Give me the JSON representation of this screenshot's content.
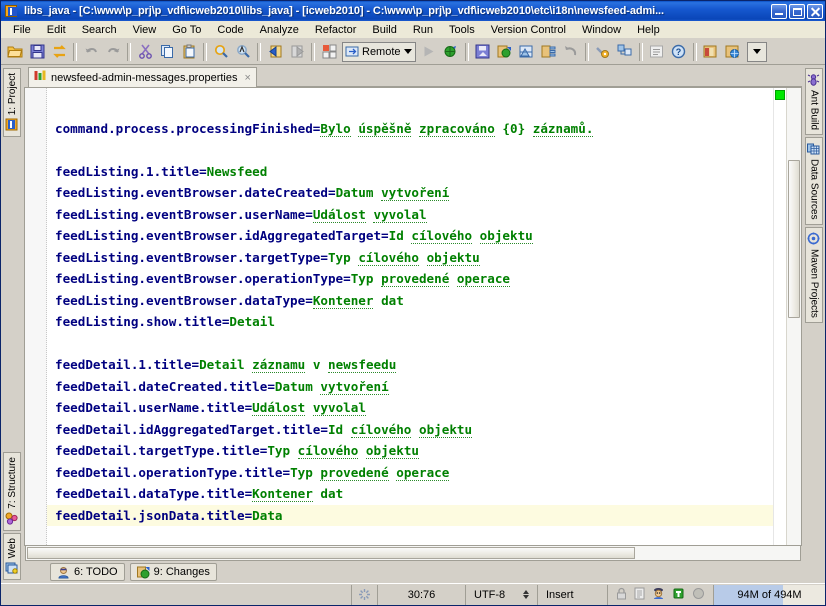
{
  "window": {
    "title": "libs_java - [C:\\www\\p_prj\\p_vdf\\icweb2010\\libs_java] - [icweb2010] - C:\\www\\p_prj\\p_vdf\\icweb2010\\etc\\i18n\\newsfeed-admi...",
    "minimize_label": "Minimize",
    "maximize_label": "Maximize",
    "close_label": "Close"
  },
  "menubar": {
    "items": [
      {
        "label": "File"
      },
      {
        "label": "Edit"
      },
      {
        "label": "Search"
      },
      {
        "label": "View"
      },
      {
        "label": "Go To"
      },
      {
        "label": "Code"
      },
      {
        "label": "Analyze"
      },
      {
        "label": "Refactor"
      },
      {
        "label": "Build"
      },
      {
        "label": "Run"
      },
      {
        "label": "Tools"
      },
      {
        "label": "Version Control"
      },
      {
        "label": "Window"
      },
      {
        "label": "Help"
      }
    ]
  },
  "toolbar": {
    "buttons": [
      {
        "name": "open-folder-icon",
        "title": "Open"
      },
      {
        "name": "save-all-icon",
        "title": "Save All"
      },
      {
        "name": "synchronize-icon",
        "title": "Synchronize"
      },
      {
        "name": "undo-icon",
        "title": "Undo"
      },
      {
        "name": "redo-icon",
        "title": "Redo"
      },
      {
        "name": "cut-icon",
        "title": "Cut"
      },
      {
        "name": "copy-icon",
        "title": "Copy"
      },
      {
        "name": "paste-icon",
        "title": "Paste"
      },
      {
        "name": "find-icon",
        "title": "Find"
      },
      {
        "name": "replace-icon",
        "title": "Replace"
      },
      {
        "name": "back-icon",
        "title": "Back"
      },
      {
        "name": "forward-icon",
        "title": "Forward"
      },
      {
        "name": "toggle-bookmark-icon",
        "title": "Toggle Bookmark"
      }
    ],
    "run_config": {
      "label": "Remote"
    },
    "buttons2": [
      {
        "name": "run-icon",
        "title": "Run"
      },
      {
        "name": "debug-icon",
        "title": "Debug"
      },
      {
        "name": "update-project-icon",
        "title": "Update Project"
      },
      {
        "name": "commit-icon",
        "title": "Commit Changes"
      },
      {
        "name": "compare-icon",
        "title": "Compare with the Same Repository Version"
      },
      {
        "name": "show-history-icon",
        "title": "Show History"
      },
      {
        "name": "rollback-icon",
        "title": "Rollback"
      },
      {
        "name": "settings-icon",
        "title": "Settings"
      },
      {
        "name": "project-structure-icon",
        "title": "Project Structure"
      },
      {
        "name": "context-help-icon",
        "title": "Context Help"
      },
      {
        "name": "help-icon",
        "title": "Help Topics"
      },
      {
        "name": "database-icon",
        "title": "Database"
      },
      {
        "name": "web-icon",
        "title": "Web"
      }
    ],
    "overflow_label": "More"
  },
  "left_strip": {
    "top_tabs": [
      {
        "label": "1: Project",
        "icon": "project-icon"
      }
    ],
    "bottom_tabs": [
      {
        "label": "7: Structure",
        "icon": "structure-icon"
      },
      {
        "label": "Web",
        "icon": "web-icon"
      }
    ]
  },
  "right_strip": {
    "tabs": [
      {
        "label": "Ant Build",
        "icon": "ant-icon"
      },
      {
        "label": "Data Sources",
        "icon": "database-icon"
      },
      {
        "label": "Maven Projects",
        "icon": "maven-icon"
      }
    ]
  },
  "editor": {
    "tab": {
      "filename": "newsfeed-admin-messages.properties",
      "icon": "properties-file-icon",
      "close_label": "×"
    },
    "inspection_status": "ok",
    "lines": [
      {
        "key": "",
        "value": "",
        "blank": true
      },
      {
        "key": "command.process.processingFinished",
        "value": "Bylo úspěšně zpracováno {0} záznamů.",
        "spell": "Bylo úspěšně zpracováno záznamů"
      },
      {
        "key": "",
        "value": "",
        "blank": true
      },
      {
        "key": "feedListing.1.title",
        "value": "Newsfeed"
      },
      {
        "key": "feedListing.eventBrowser.dateCreated",
        "value": "Datum vytvoření",
        "spell": "vytvoření"
      },
      {
        "key": "feedListing.eventBrowser.userName",
        "value": "Událost vyvolal",
        "spell": "Událost vyvolal"
      },
      {
        "key": "feedListing.eventBrowser.idAggregatedTarget",
        "value": "Id cílového objektu",
        "spell": "cílového objektu"
      },
      {
        "key": "feedListing.eventBrowser.targetType",
        "value": "Typ cílového objektu",
        "spell": "cílového objektu"
      },
      {
        "key": "feedListing.eventBrowser.operationType",
        "value": "Typ provedené operace",
        "spell": "provedené operace"
      },
      {
        "key": "feedListing.eventBrowser.dataType",
        "value": "Kontener dat",
        "spell": "Kontener"
      },
      {
        "key": "feedListing.show.title",
        "value": "Detail"
      },
      {
        "key": "",
        "value": "",
        "blank": true
      },
      {
        "key": "feedDetail.1.title",
        "value": "Detail záznamu v newsfeedu",
        "spell": "záznamu newsfeedu"
      },
      {
        "key": "feedDetail.dateCreated.title",
        "value": "Datum vytvoření",
        "spell": "vytvoření"
      },
      {
        "key": "feedDetail.userName.title",
        "value": "Událost vyvolal",
        "spell": "Událost vyvolal"
      },
      {
        "key": "feedDetail.idAggregatedTarget.title",
        "value": "Id cílového objektu",
        "spell": "cílového objektu"
      },
      {
        "key": "feedDetail.targetType.title",
        "value": "Typ cílového objektu",
        "spell": "cílového objektu"
      },
      {
        "key": "feedDetail.operationType.title",
        "value": "Typ provedené operace",
        "spell": "provedené operace"
      },
      {
        "key": "feedDetail.dataType.title",
        "value": "Kontener dat",
        "spell": "Kontener"
      },
      {
        "key": "feedDetail.jsonData.title",
        "value": "Data",
        "highlight": true
      }
    ]
  },
  "bottom_tools": [
    {
      "label": "6: TODO",
      "icon": "todo-icon"
    },
    {
      "label": "9: Changes",
      "icon": "changes-icon"
    }
  ],
  "statusbar": {
    "message": "",
    "background_task_icon": "spinner-icon",
    "caret_position": "30:76",
    "encoding": "UTF-8",
    "insert_mode": "Insert",
    "lock_icon": "lock-icon",
    "readonly_icon": "file-icon",
    "hector_icon": "hector-inspector-icon",
    "hector2_icon": "power-save-icon",
    "toggle_icon": "gray-toggle-icon",
    "memory": "94M of 494M"
  },
  "colors": {
    "title_blue": "#1658cf",
    "chrome": "#d4d0c8",
    "menu_bg": "#ece9d8",
    "key_color": "#000080",
    "value_color": "#008000",
    "highlight_line": "#fdfbe0",
    "ok_green": "#00e800",
    "memory_fill": "#b8cbe8"
  }
}
